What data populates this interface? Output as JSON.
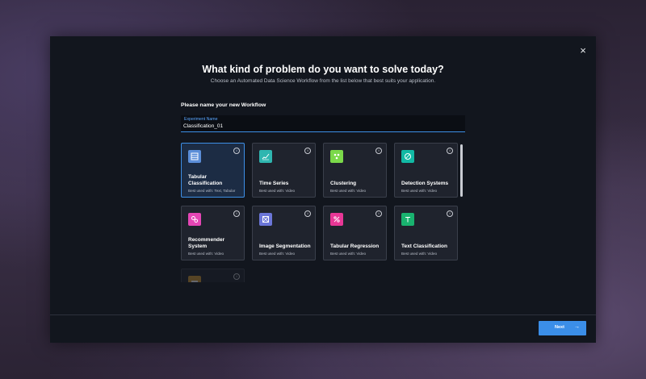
{
  "dialog": {
    "close_icon": "×",
    "title": "What kind of problem do you want to solve today?",
    "subtitle": "Choose an Automated Data Science Workflow from the list below that best suits your application.",
    "name_prompt": "Please name your new Workflow",
    "experiment_field": {
      "label": "Experiment Name",
      "value": "Classification_01"
    }
  },
  "workflows": [
    {
      "title": "Tabular Classification",
      "best_used": "Best used with: Text, Tabular",
      "icon": "table-icon",
      "color": "#5b8ed8",
      "selected": true
    },
    {
      "title": "Time Series",
      "best_used": "Best used with: Video",
      "icon": "line-chart-icon",
      "color": "#2fb6b0"
    },
    {
      "title": "Clustering",
      "best_used": "Best used with: Video",
      "icon": "cluster-icon",
      "color": "#7bd94a"
    },
    {
      "title": "Detection Systems",
      "best_used": "Best used with: Video",
      "icon": "detection-icon",
      "color": "#12b9a4"
    },
    {
      "title": "Recommender System",
      "best_used": "Best used with: Video",
      "icon": "gears-icon",
      "color": "#e546b5"
    },
    {
      "title": "Image Segmentation",
      "best_used": "Best used with: Video",
      "icon": "segmentation-icon",
      "color": "#6b76d8"
    },
    {
      "title": "Tabular Regression",
      "best_used": "Best used with: Video",
      "icon": "percent-icon",
      "color": "#e83796"
    },
    {
      "title": "Text Classification",
      "best_used": "Best used with: Video",
      "icon": "text-icon",
      "color": "#19b26f"
    },
    {
      "title": "",
      "best_used": "",
      "icon": "folder-icon",
      "color": "#d69a33"
    }
  ],
  "footer": {
    "next_label": "Next",
    "next_arrow": "→"
  }
}
